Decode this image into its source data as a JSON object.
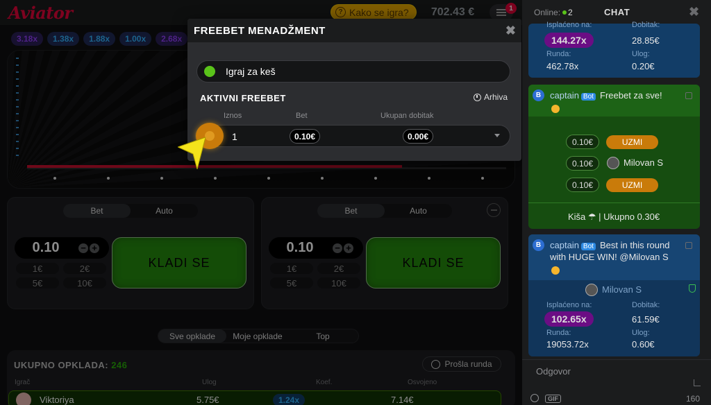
{
  "app": {
    "logo": "Aviator",
    "howto_label": "Kako se igra?",
    "balance": "702.43 €",
    "menu_badge": "1"
  },
  "multipliers": [
    {
      "text": "3.18x",
      "color": "purple"
    },
    {
      "text": "1.38x",
      "color": "blue"
    },
    {
      "text": "1.88x",
      "color": "blue"
    },
    {
      "text": "1.00x",
      "color": "blue"
    },
    {
      "text": "2.68x",
      "color": "purple"
    }
  ],
  "bet_panels": [
    {
      "tab_bet": "Bet",
      "tab_auto": "Auto",
      "amount": "0.10",
      "quick": [
        "1€",
        "2€",
        "5€",
        "10€"
      ],
      "button": "KLADI SE"
    },
    {
      "tab_bet": "Bet",
      "tab_auto": "Auto",
      "amount": "0.10",
      "quick": [
        "1€",
        "2€",
        "5€",
        "10€"
      ],
      "button": "KLADI SE"
    }
  ],
  "bets_section": {
    "tabs": [
      "Sve opklade",
      "Moje opklade",
      "Top"
    ],
    "total_label": "UKUPNO OPKLADA:",
    "total_count": "246",
    "previous_round": "Prošla runda",
    "columns": [
      "Igrač",
      "Ulog",
      "Koef.",
      "Osvojeno"
    ],
    "rows": [
      {
        "player": "Viktoriya",
        "stake": "5.75€",
        "coef": "1.24x",
        "won": "7.14€"
      }
    ]
  },
  "modal": {
    "title": "FREEBET MENADŽMENT",
    "cash_toggle_label": "Igraj za keš",
    "active_title": "AKTIVNI FREEBET",
    "archive_label": "Arhiva",
    "columns": [
      "Iznos",
      "Bet",
      "Ukupan dobitak"
    ],
    "row": {
      "count": "1",
      "bet": "0.10€",
      "total": "0.00€"
    }
  },
  "chat": {
    "online_label": "Online:",
    "online_count": "2",
    "title": "CHAT",
    "top_card": {
      "isplaceno_label": "Isplaćeno na:",
      "dobitak_label": "Dobitak:",
      "multiplier": "144.27x",
      "dobitak": "28.85€",
      "runda_label": "Runda:",
      "ulog_label": "Ulog:",
      "runda": "462.78x",
      "ulog": "0.20€"
    },
    "freebet_msg": {
      "avatar": "B",
      "author": "captain",
      "bot": "Bot",
      "text": "Freebet za sve!",
      "claims": [
        {
          "amount": "0.10€",
          "action": "UZMI"
        },
        {
          "amount": "0.10€",
          "user": "Milovan S"
        },
        {
          "amount": "0.10€",
          "action": "UZMI"
        }
      ],
      "footer": "Kiša ☂ | Ukupno 0.30€"
    },
    "win_msg": {
      "avatar": "B",
      "author": "captain",
      "bot": "Bot",
      "text_line1": "Best in this round",
      "text_line2": "with HUGE WIN! @Milovan S",
      "user": "Milovan S",
      "isplaceno_label": "Isplaćeno na:",
      "dobitak_label": "Dobitak:",
      "multiplier": "102.65x",
      "dobitak": "61.59€",
      "runda_label": "Runda:",
      "ulog_label": "Ulog:",
      "runda": "19053.72x",
      "ulog": "0.60€"
    },
    "reply_placeholder": "Odgovor",
    "gif": "GIF",
    "char_count": "160"
  }
}
